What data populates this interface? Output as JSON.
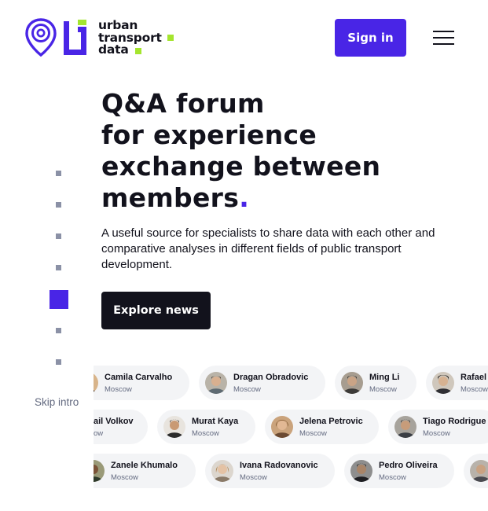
{
  "header": {
    "logo_lines": [
      "urban",
      "transport",
      "data"
    ],
    "signin_label": "Sign in",
    "menu_label": "menu"
  },
  "hero": {
    "headline_lines": [
      "Q&A forum",
      "for experience",
      "exchange between",
      "members"
    ],
    "headline_dot": ".",
    "lead": "A useful source for specialists to share data with each other and comparative analyses in different fields of public transport development.",
    "explore_label": "Explore news"
  },
  "pager": {
    "slides": 7,
    "active_index": 4,
    "skip_label": "Skip intro"
  },
  "members": {
    "rows": [
      [
        {
          "name": "Camila Carvalho",
          "city": "Moscow"
        },
        {
          "name": "Dragan Obradovic",
          "city": "Moscow"
        },
        {
          "name": "Ming Li",
          "city": "Moscow"
        },
        {
          "name": "Rafael",
          "city": "Moscow"
        }
      ],
      [
        {
          "name": "ail Volkov",
          "city": "ow"
        },
        {
          "name": "Murat Kaya",
          "city": "Moscow"
        },
        {
          "name": "Jelena Petrovic",
          "city": "Moscow"
        },
        {
          "name": "Tiago Rodrigue",
          "city": "Moscow"
        }
      ],
      [
        {
          "name": "Zanele Khumalo",
          "city": "Moscow"
        },
        {
          "name": "Ivana Radovanovic",
          "city": "Moscow"
        },
        {
          "name": "Pedro Oliveira",
          "city": "Moscow"
        },
        {
          "name": "",
          "city": ""
        }
      ]
    ]
  },
  "colors": {
    "accent": "#4925e6",
    "lime": "#a4e52e",
    "ink": "#12121c",
    "chip_bg": "#f3f4f6",
    "muted": "#636a80"
  }
}
